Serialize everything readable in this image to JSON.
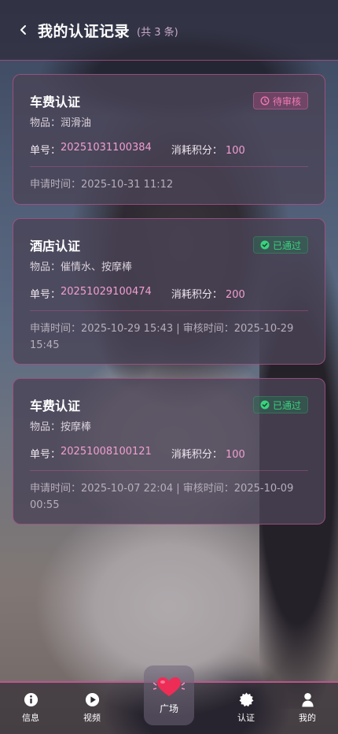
{
  "header": {
    "title": "我的认证记录",
    "count_text": "(共 3 条)"
  },
  "records": [
    {
      "title": "车费认证",
      "status": "待审核",
      "status_type": "pending",
      "item": "物品：润滑油",
      "order_label": "单号：",
      "order_no": "20251031100384",
      "points_label": "消耗积分：",
      "points": "100",
      "time_text": "申请时间：2025-10-31 11:12"
    },
    {
      "title": "酒店认证",
      "status": "已通过",
      "status_type": "passed",
      "item": "物品：催情水、按摩棒",
      "order_label": "单号：",
      "order_no": "20251029100474",
      "points_label": "消耗积分：",
      "points": "200",
      "time_text": "申请时间：2025-10-29 15:43 | 审核时间：2025-10-29 15:45"
    },
    {
      "title": "车费认证",
      "status": "已通过",
      "status_type": "passed",
      "item": "物品：按摩棒",
      "order_label": "单号：",
      "order_no": "20251008100121",
      "points_label": "消耗积分：",
      "points": "100",
      "time_text": "申请时间：2025-10-07 22:04 | 审核时间：2025-10-09 00:55"
    }
  ],
  "nav": {
    "items": [
      {
        "label": "信息",
        "icon": "info-icon"
      },
      {
        "label": "视频",
        "icon": "play-icon"
      },
      {
        "label": "广场",
        "icon": "heart-icon"
      },
      {
        "label": "认证",
        "icon": "badge-icon"
      },
      {
        "label": "我的",
        "icon": "user-icon"
      }
    ]
  },
  "colors": {
    "accent_pink": "#f29ed0",
    "pending": "#f07ab4",
    "passed": "#39d27e",
    "border": "#dc5aa0"
  }
}
